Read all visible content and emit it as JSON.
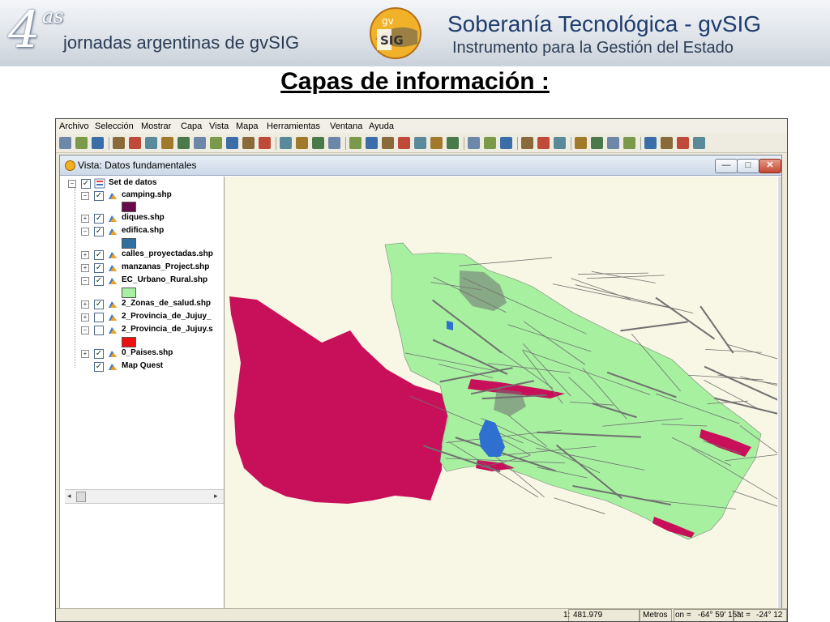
{
  "slide": {
    "banner_number": "4",
    "banner_suffix": "as",
    "banner_event": "jornadas argentinas de gvSIG",
    "logo_top": "gv",
    "logo_bottom": "SIG",
    "banner_title": "Soberanía Tecnológica - gvSIG",
    "banner_subtitle": "Instrumento para la Gestión del Estado",
    "title": "Capas de información :"
  },
  "menu": [
    "Archivo",
    "Selección",
    "Mostrar",
    "Capa",
    "Vista",
    "Mapa",
    "Herramientas",
    "Ventana",
    "Ayuda"
  ],
  "toolbar_icons": [
    "new-icon",
    "open-icon",
    "save-icon",
    "pan-icon",
    "zoom-full-icon",
    "zoom-extent-icon",
    "zoom-in-icon",
    "zoom-out-icon",
    "zoom-layer-icon",
    "layers-icon",
    "eraser-icon",
    "add-layer-icon",
    "image-icon",
    "locator-icon",
    "info-icon",
    "measure-icon",
    "print-icon",
    "globe-icon",
    "pointer-icon",
    "select-icon",
    "select-polygon-icon",
    "select-circle-icon",
    "select-area-icon",
    "search-icon",
    "shape-icon",
    "earth-icon",
    "gear-icon",
    "filter-icon",
    "stop-icon",
    "tools-icon",
    "export-icon",
    "table-icon",
    "copy-icon",
    "layout-icon",
    "query-icon",
    "grid-icon",
    "document-icon",
    "edit-icon"
  ],
  "view": {
    "title": "Vista: Datos fundamentales",
    "min_label": "—",
    "max_label": "□",
    "close_label": "✕"
  },
  "toc": {
    "root": "Set de datos",
    "layers": [
      {
        "name": "camping.shp",
        "checked": true,
        "expanded": true,
        "swatch": "#6a0a4a"
      },
      {
        "name": "diques.shp",
        "checked": true,
        "expanded": false
      },
      {
        "name": "edifica.shp",
        "checked": true,
        "expanded": true,
        "swatch": "#2f6fa0"
      },
      {
        "name": "calles_proyectadas.shp",
        "checked": true,
        "expanded": false
      },
      {
        "name": "manzanas_Project.shp",
        "checked": true,
        "expanded": false
      },
      {
        "name": "EC_Urbano_Rural.shp",
        "checked": true,
        "expanded": true,
        "swatch": "#a6f0a0"
      },
      {
        "name": "2_Zonas_de_salud.shp",
        "checked": true,
        "expanded": false
      },
      {
        "name": "2_Provincia_de_Jujuy_",
        "checked": false,
        "expanded": false
      },
      {
        "name": "2_Provincia_de_Jujuy.s",
        "checked": false,
        "expanded": true,
        "swatch": "#ee1010"
      },
      {
        "name": "0_Paises.shp",
        "checked": true,
        "expanded": false
      },
      {
        "name": "Map Quest",
        "checked": true,
        "expanded": false
      }
    ]
  },
  "status": {
    "scale_prefix": "1:",
    "scale": "481.979",
    "units": "Metros",
    "lon_label": "on =",
    "lon": "-64° 59' 15\"",
    "lat_label": "at =",
    "lat": "-24° 12"
  },
  "colors": {
    "urban_rural": "#a6f0a0",
    "health_zones": "#c8105a",
    "streets": "#707070",
    "water": "#2f6fd0",
    "map_background": "#f8f6e4"
  }
}
